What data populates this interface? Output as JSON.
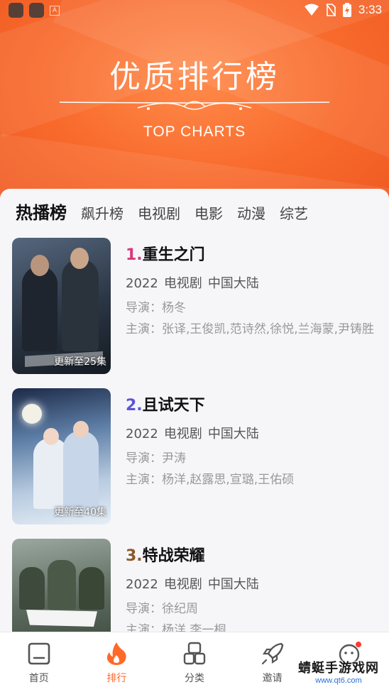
{
  "status_bar": {
    "time": "3:33",
    "a_label": "A"
  },
  "banner": {
    "title": "优质排行榜",
    "subtitle": "TOP CHARTS"
  },
  "tabs": [
    {
      "label": "热播榜",
      "active": true
    },
    {
      "label": "飙升榜",
      "active": false
    },
    {
      "label": "电视剧",
      "active": false
    },
    {
      "label": "电影",
      "active": false
    },
    {
      "label": "动漫",
      "active": false
    },
    {
      "label": "综艺",
      "active": false
    }
  ],
  "items": [
    {
      "rank": "1.",
      "rank_color": "#d63a7a",
      "title": "重生之门",
      "year": "2022",
      "type": "电视剧",
      "region": "中国大陆",
      "director": "导演：杨冬",
      "cast": "主演：张译,王俊凯,范诗然,徐悦,兰海蒙,尹铸胜",
      "badge": "更新至25集",
      "poster_colors": [
        "#3b4a5e",
        "#1c2430"
      ]
    },
    {
      "rank": "2.",
      "rank_color": "#5b55d6",
      "title": "且试天下",
      "year": "2022",
      "type": "电视剧",
      "region": "中国大陆",
      "director": "导演：尹涛",
      "cast": "主演：杨洋,赵露思,宣璐,王佑硕",
      "badge": "更新至40集",
      "poster_colors": [
        "#8fb4d8",
        "#2a3a5a"
      ]
    },
    {
      "rank": "3.",
      "rank_color": "#8a5a2a",
      "title": "特战荣耀",
      "year": "2022",
      "type": "电视剧",
      "region": "中国大陆",
      "director": "导演：徐纪周",
      "cast": "主演：杨洋,李一桐",
      "badge": "",
      "poster_colors": [
        "#6b7a6a",
        "#2b352c"
      ]
    }
  ],
  "bottom_nav": [
    {
      "label": "首页",
      "icon": "home-icon",
      "active": false
    },
    {
      "label": "排行",
      "icon": "flame-icon",
      "active": true
    },
    {
      "label": "分类",
      "icon": "category-icon",
      "active": false
    },
    {
      "label": "邀请",
      "icon": "rocket-icon",
      "active": false
    },
    {
      "label": "我的",
      "icon": "smiley-icon",
      "active": false
    }
  ],
  "watermark": {
    "line1": "蜻蜓手游戏网",
    "line2": "www.qt6.com"
  },
  "colors": {
    "accent": "#ff6a2a",
    "banner": "#f86a2c"
  }
}
